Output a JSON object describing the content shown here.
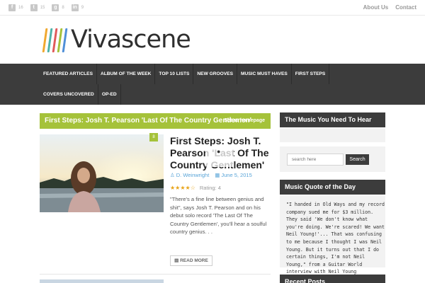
{
  "social": [
    {
      "glyph": "f",
      "count": "16",
      "icon": "facebook-icon"
    },
    {
      "glyph": "t",
      "count": "15",
      "icon": "twitter-icon"
    },
    {
      "glyph": "g",
      "count": "8",
      "icon": "googleplus-icon"
    },
    {
      "glyph": "in",
      "count": "9",
      "icon": "linkedin-icon"
    }
  ],
  "toplinks": [
    "About Us",
    "Contact"
  ],
  "logo": {
    "text": "Vivascene",
    "bar_colors": [
      "#f0a830",
      "#4fb3a8",
      "#e05a5a",
      "#a5c23a",
      "#4f8fd8"
    ]
  },
  "nav": [
    "Featured Articles",
    "Album Of The Week",
    "Top 10 Lists",
    "New Grooves",
    "Music Must Haves",
    "First Steps",
    "Covers Uncovered",
    "Op-Ed"
  ],
  "headline": {
    "title": "First Steps: Josh T. Pearson 'Last Of The Country Gentlemen'",
    "sub": "Set as homepage"
  },
  "post": {
    "badge": "8",
    "title": "First Steps: Josh T. Pearson 'Last Of The Country Gentlemen'",
    "author": "D. Weinwright",
    "date": "June 5, 2015",
    "rating_label": "Rating: 4",
    "stars": "★★★★☆",
    "excerpt": "\"There's a fine line between genius and shit\", says Josh T. Pearson and on his debut solo record 'The Last Of The Country Gentlemen', you'll hear a soulful country genius. . .",
    "read_more": "READ MORE"
  },
  "sidebar": {
    "music_title": "The Music You Need To Hear",
    "search_placeholder": "search here",
    "search_button": "Search",
    "quote_title": "Music Quote of the Day",
    "quote": "\"I handed in Old Ways and my record company sued me for $3 million. They said 'We don't know what you're doing. We're scared! We want Neil Young!'... That was confusing to me because I thought I was Neil Young. But it turns out that I do certain things, I'm not Neil Young,\" from a Guitar World interview with Neil Young",
    "recent_title": "Recent Posts"
  },
  "colors": {
    "accent": "#a5c23a",
    "nav_bg": "#3c3c3c",
    "link": "#5aa5d8"
  }
}
